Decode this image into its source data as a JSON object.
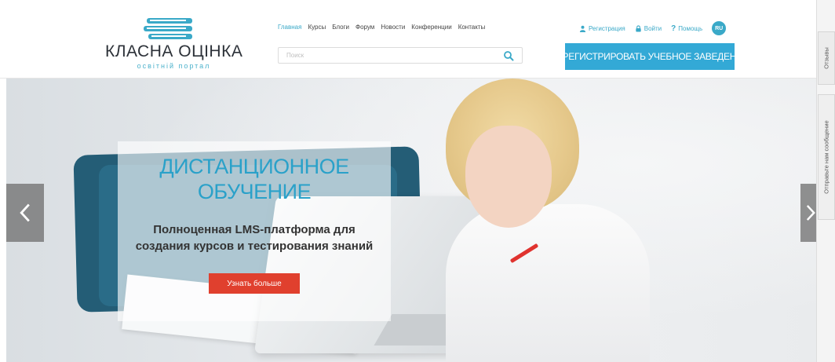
{
  "logo": {
    "title": "КЛАСНА ОЦІНКА",
    "subtitle": "освітній портал"
  },
  "nav": {
    "items": [
      {
        "label": "Главная",
        "active": true
      },
      {
        "label": "Курсы",
        "active": false
      },
      {
        "label": "Блоги",
        "active": false
      },
      {
        "label": "Форум",
        "active": false
      },
      {
        "label": "Новости",
        "active": false
      },
      {
        "label": "Конференции",
        "active": false
      },
      {
        "label": "Контакты",
        "active": false
      }
    ]
  },
  "search": {
    "placeholder": "Поиск",
    "icon": "search-icon"
  },
  "user_bar": {
    "register": "Регистрация",
    "login": "Войти",
    "help": "Помощь",
    "lang": "RU"
  },
  "register_school_button": "ЗАРЕГИСТРИРОВАТЬ УЧЕБНОЕ ЗАВЕДЕНИЕ",
  "side_tabs": {
    "feedback": "Отзывы",
    "message": "Отправьте нам сообщение"
  },
  "hero": {
    "title_line1": "ДИСТАНЦИОННОЕ",
    "title_line2": "ОБУЧЕНИЕ",
    "text": "Полноценная LMS-платформа для создания курсов и тестирования знаний",
    "button": "Узнать больше"
  },
  "colors": {
    "accent": "#33a9d6",
    "cta": "#e0402e",
    "text_dark": "#2c3138"
  }
}
